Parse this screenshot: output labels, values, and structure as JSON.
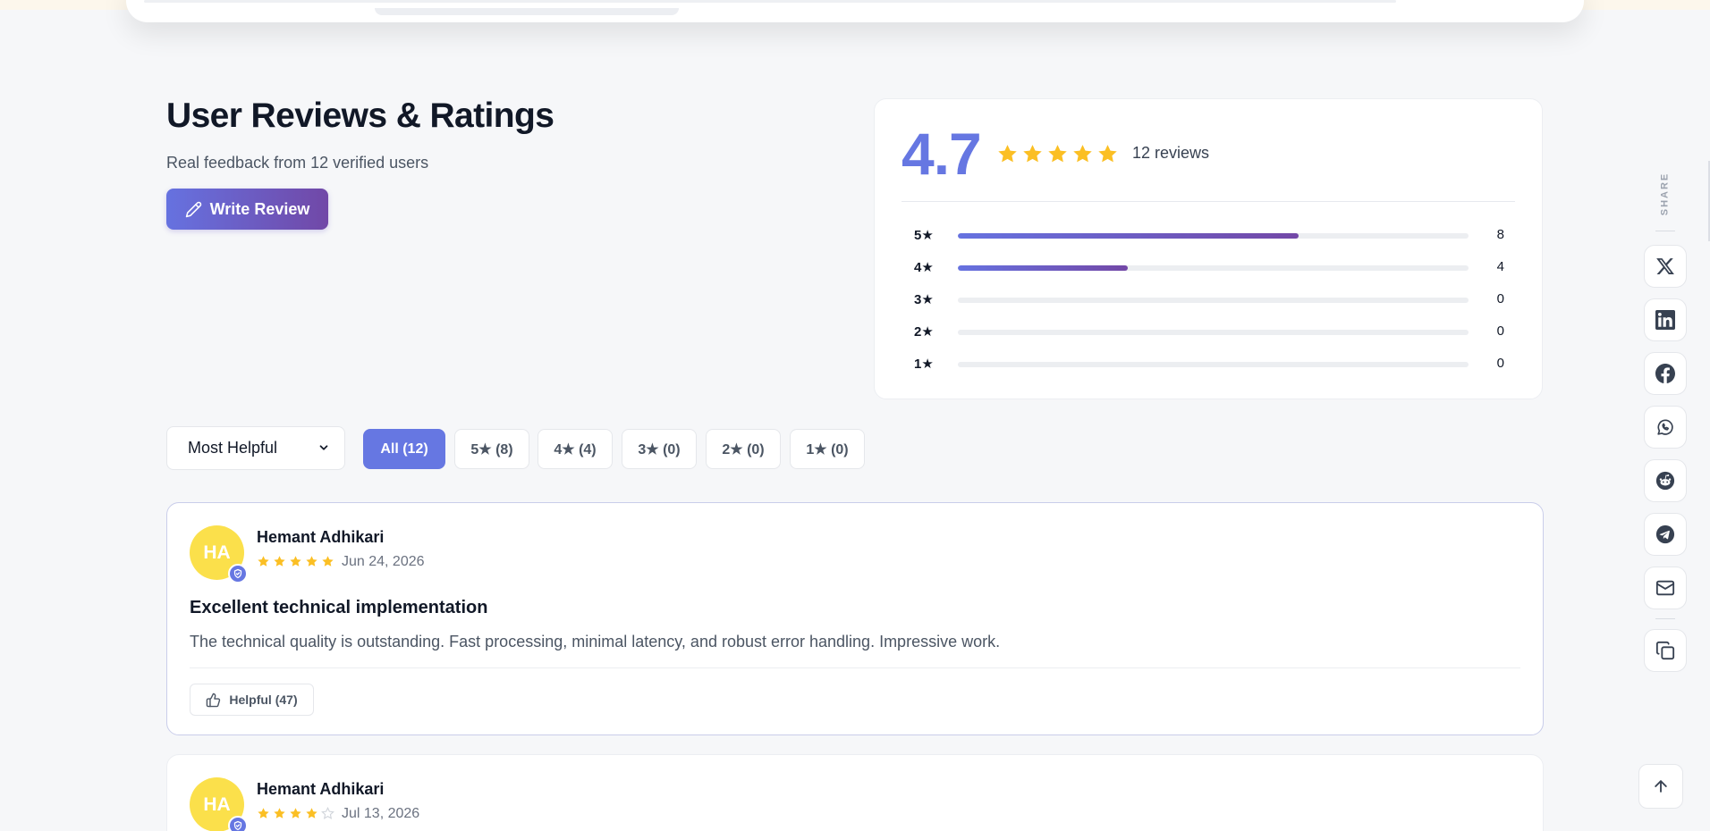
{
  "header": {
    "title": "User Reviews & Ratings",
    "subtitle": "Real feedback from 12 verified users",
    "write_review_label": "Write Review"
  },
  "summary": {
    "average": "4.7",
    "count_label": "12 reviews",
    "distribution": [
      {
        "label": "5★",
        "count": "8",
        "fraction": 0.667
      },
      {
        "label": "4★",
        "count": "4",
        "fraction": 0.333
      },
      {
        "label": "3★",
        "count": "0",
        "fraction": 0
      },
      {
        "label": "2★",
        "count": "0",
        "fraction": 0
      },
      {
        "label": "1★",
        "count": "0",
        "fraction": 0
      }
    ]
  },
  "filters": {
    "sort_value": "Most Helpful",
    "chips": [
      "All (12)",
      "5★ (8)",
      "4★ (4)",
      "3★ (0)",
      "2★ (0)",
      "1★ (0)"
    ],
    "active_chip": "All (12)"
  },
  "reviews": [
    {
      "initials": "HA",
      "author": "Hemant Adhikari",
      "rating": 5,
      "date": "Jun 24, 2026",
      "title": "Excellent technical implementation",
      "body": "The technical quality is outstanding. Fast processing, minimal latency, and robust error handling. Impressive work.",
      "helpful_label": "Helpful (47)"
    },
    {
      "initials": "HA",
      "author": "Hemant Adhikari",
      "rating": 4,
      "date": "Jul 13, 2026"
    }
  ],
  "share": {
    "label": "SHARE",
    "icons": [
      "x-icon",
      "linkedin-icon",
      "facebook-icon",
      "whatsapp-icon",
      "reddit-icon",
      "telegram-icon",
      "email-icon",
      "copy-link-icon"
    ]
  },
  "colors": {
    "accent": "#6677e2",
    "gradient_end": "#7148a7",
    "star": "#fbbf24",
    "avatar": "#fbe04b"
  }
}
